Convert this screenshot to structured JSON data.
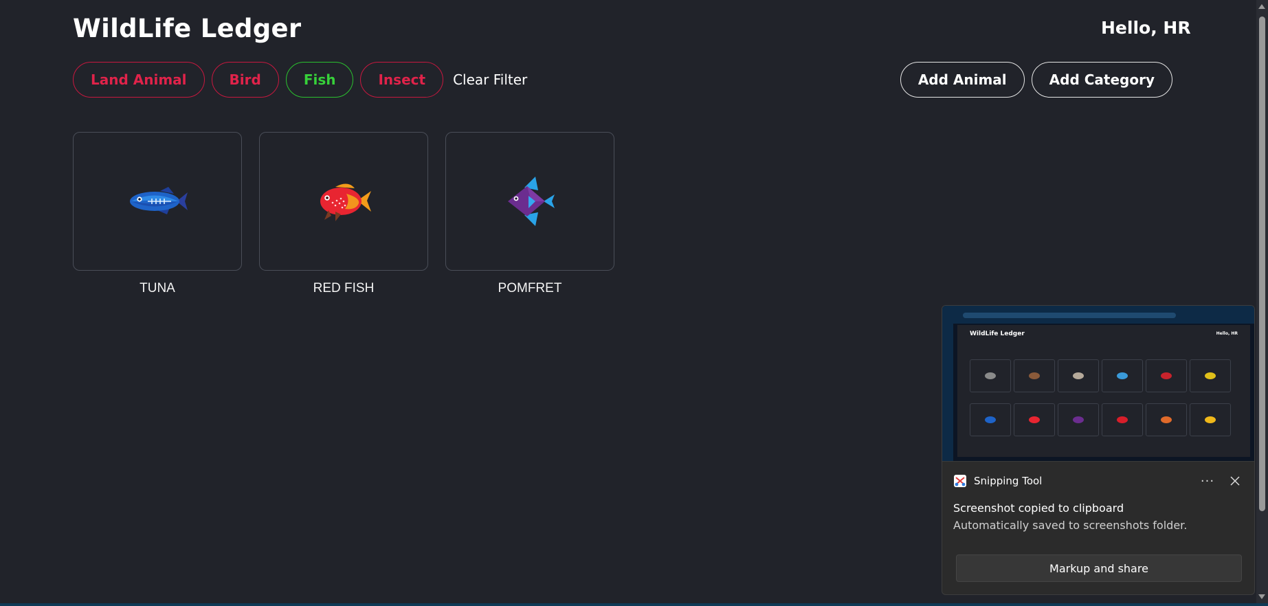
{
  "header": {
    "title": "WildLife Ledger",
    "greeting": "Hello, HR"
  },
  "filters": [
    {
      "label": "Land Animal",
      "active": false
    },
    {
      "label": "Bird",
      "active": false
    },
    {
      "label": "Fish",
      "active": true
    },
    {
      "label": "Insect",
      "active": false
    }
  ],
  "clear_filter_label": "Clear Filter",
  "actions": {
    "add_animal": "Add Animal",
    "add_category": "Add Category"
  },
  "animals": [
    {
      "name": "TUNA",
      "icon": "tuna-fish-icon"
    },
    {
      "name": "RED FISH",
      "icon": "red-fish-icon"
    },
    {
      "name": "POMFRET",
      "icon": "pomfret-fish-icon"
    }
  ],
  "colors": {
    "background": "#21232a",
    "chip_inactive": "#e0234a",
    "chip_active": "#37d13a"
  },
  "toast": {
    "app_name": "Snipping Tool",
    "more_label": "···",
    "message_title": "Screenshot copied to clipboard",
    "message_body": "Automatically saved to screenshots folder.",
    "action_label": "Markup and share",
    "preview": {
      "title": "WildLife Ledger",
      "greeting": "Hello, HR"
    }
  }
}
